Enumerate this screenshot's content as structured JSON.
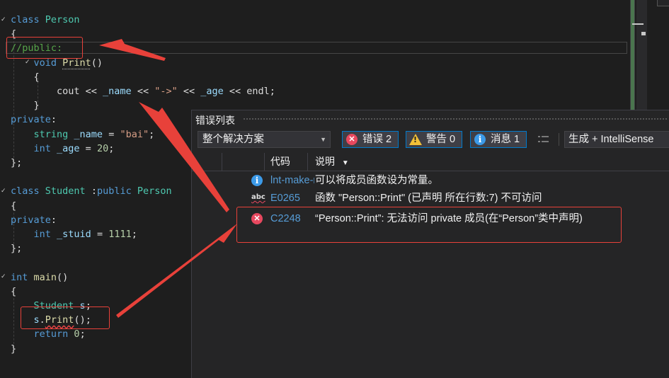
{
  "editor": {
    "lines": [
      {
        "tokens": [
          [
            "kw",
            "class "
          ],
          [
            "ty",
            "Person"
          ]
        ]
      },
      {
        "tokens": [
          [
            "pl",
            "{"
          ]
        ]
      },
      {
        "tokens": [
          [
            "cm",
            "//public:"
          ]
        ]
      },
      {
        "tokens": [
          [
            "pl",
            "    "
          ],
          [
            "kw",
            "void "
          ],
          [
            "fn",
            "Print"
          ],
          [
            "pl",
            "()"
          ]
        ]
      },
      {
        "tokens": [
          [
            "pl",
            "    {"
          ]
        ]
      },
      {
        "tokens": [
          [
            "pl",
            "        cout << "
          ],
          [
            "va",
            "_name"
          ],
          [
            "pl",
            " << "
          ],
          [
            "st",
            "\"->\""
          ],
          [
            "pl",
            " << "
          ],
          [
            "va",
            "_age"
          ],
          [
            "pl",
            " << endl;"
          ]
        ]
      },
      {
        "tokens": [
          [
            "pl",
            "    }"
          ]
        ]
      },
      {
        "tokens": [
          [
            "kw",
            "private"
          ],
          [
            "pl",
            ":"
          ]
        ]
      },
      {
        "tokens": [
          [
            "pl",
            "    "
          ],
          [
            "ty",
            "string "
          ],
          [
            "va",
            "_name"
          ],
          [
            "pl",
            " = "
          ],
          [
            "st",
            "\"bai\""
          ],
          [
            "pl",
            ";"
          ]
        ]
      },
      {
        "tokens": [
          [
            "pl",
            "    "
          ],
          [
            "kw",
            "int "
          ],
          [
            "va",
            "_age"
          ],
          [
            "pl",
            " = "
          ],
          [
            "nm",
            "20"
          ],
          [
            "pl",
            ";"
          ]
        ]
      },
      {
        "tokens": [
          [
            "pl",
            "};"
          ]
        ]
      },
      {
        "tokens": [
          [
            "pl",
            ""
          ]
        ]
      },
      {
        "tokens": [
          [
            "kw",
            "class "
          ],
          [
            "ty",
            "Student "
          ],
          [
            "pl",
            ":"
          ],
          [
            "kw",
            "public "
          ],
          [
            "ty",
            "Person"
          ]
        ]
      },
      {
        "tokens": [
          [
            "pl",
            "{"
          ]
        ]
      },
      {
        "tokens": [
          [
            "kw",
            "private"
          ],
          [
            "pl",
            ":"
          ]
        ]
      },
      {
        "tokens": [
          [
            "pl",
            "    "
          ],
          [
            "kw",
            "int "
          ],
          [
            "va",
            "_stuid"
          ],
          [
            "pl",
            " = "
          ],
          [
            "nm",
            "1111"
          ],
          [
            "pl",
            ";"
          ]
        ]
      },
      {
        "tokens": [
          [
            "pl",
            "};"
          ]
        ]
      },
      {
        "tokens": [
          [
            "pl",
            ""
          ]
        ]
      },
      {
        "tokens": [
          [
            "kw",
            "int "
          ],
          [
            "fn",
            "main"
          ],
          [
            "pl",
            "()"
          ]
        ]
      },
      {
        "tokens": [
          [
            "pl",
            "{"
          ]
        ]
      },
      {
        "tokens": [
          [
            "pl",
            "    "
          ],
          [
            "ty",
            "Student "
          ],
          [
            "va",
            "s"
          ],
          [
            "pl",
            ";"
          ]
        ]
      },
      {
        "tokens": [
          [
            "pl",
            "    "
          ],
          [
            "va",
            "s"
          ],
          [
            "pl",
            "."
          ],
          [
            "fn",
            "Print"
          ],
          [
            "pl",
            "();"
          ]
        ]
      },
      {
        "tokens": [
          [
            "pl",
            "    "
          ],
          [
            "kw",
            "return "
          ],
          [
            "nm",
            "0"
          ],
          [
            "pl",
            ";"
          ]
        ]
      },
      {
        "tokens": [
          [
            "pl",
            "}"
          ]
        ]
      }
    ]
  },
  "error_list": {
    "title": "错误列表",
    "scope": "整个解决方案",
    "errors_label": "错误 2",
    "warnings_label": "警告 0",
    "messages_label": "消息 1",
    "build_filter": "生成 + IntelliSense",
    "columns": {
      "code": "代码",
      "description": "说明"
    },
    "rows": [
      {
        "type": "info",
        "code": "lnt-make-member-function-const",
        "description": "可以将成员函数设为常量。"
      },
      {
        "type": "intellisense",
        "code": "E0265",
        "description": "函数 \"Person::Print\" (已声明 所在行数:7) 不可访问"
      },
      {
        "type": "error",
        "code": "C2248",
        "description": "“Person::Print”: 无法访问 private 成员(在“Person”类中声明)"
      }
    ]
  },
  "icons": {
    "error": "error-circle-icon",
    "warning": "warning-triangle-icon",
    "info": "info-circle-icon",
    "spell": "abc-squiggle-icon",
    "filter": "filter-icon",
    "fold": "collapse-chevron-icon"
  },
  "colors": {
    "keyword": "#569cd6",
    "type": "#4ec9b0",
    "function": "#dcdcaa",
    "comment": "#57a64a",
    "string": "#d69d85",
    "annotation": "#e8413a",
    "error": "#e8485f",
    "info": "#3c9ae8",
    "warning": "#f2c037"
  }
}
